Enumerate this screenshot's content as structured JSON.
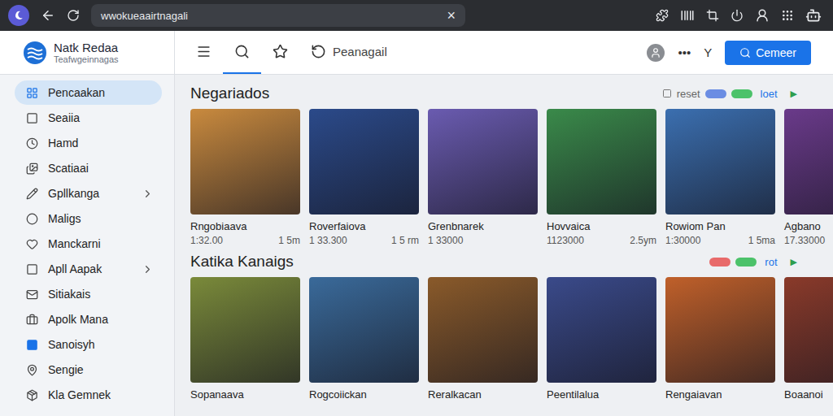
{
  "browser": {
    "address": "wwokueaairtnagali",
    "close": "×"
  },
  "app": {
    "title": "Natk Redaa",
    "subtitle": "Teafwgeinnagas"
  },
  "toolbar": {
    "tabs": [
      {
        "kind": "menu",
        "selected": false
      },
      {
        "kind": "search",
        "selected": true
      },
      {
        "kind": "star",
        "selected": false
      },
      {
        "kind": "link",
        "label": "Peanagail",
        "selected": false
      }
    ],
    "more": "•••",
    "letter": "Y",
    "button": "Cemeer"
  },
  "sidebar": {
    "items": [
      {
        "label": "Pencaakan",
        "selected": true,
        "expandable": false
      },
      {
        "label": "Seaiia",
        "selected": false,
        "expandable": false
      },
      {
        "label": "Hamd",
        "selected": false,
        "expandable": false
      },
      {
        "label": "Scatiaai",
        "selected": false,
        "expandable": false
      },
      {
        "label": "Gpllkanga",
        "selected": false,
        "expandable": true
      },
      {
        "label": "Maligs",
        "selected": false,
        "expandable": false
      },
      {
        "label": "Manckarni",
        "selected": false,
        "expandable": false
      },
      {
        "label": "Apll Aapak",
        "selected": false,
        "expandable": true
      },
      {
        "label": "Sitiakais",
        "selected": false,
        "expandable": false
      },
      {
        "label": "Apolk Mana",
        "selected": false,
        "expandable": false
      },
      {
        "label": "Sanoisyh",
        "selected": false,
        "expandable": false
      },
      {
        "label": "Sengie",
        "selected": false,
        "expandable": false
      },
      {
        "label": "Kla Gemnek",
        "selected": false,
        "expandable": false
      }
    ]
  },
  "sections": [
    {
      "title": "Negariados",
      "controls": {
        "label": "reset",
        "pills": [
          {
            "color": "#6b8de3"
          },
          {
            "color": "#4cc26a"
          }
        ],
        "link": "loet",
        "arrow": "▶"
      },
      "cards": [
        {
          "title": "Rngobiaava",
          "price": "1:32.00",
          "duration": "1 5m",
          "color": "#c98a3e"
        },
        {
          "title": "Roverfaiova",
          "price": "1 33.300",
          "duration": "1 5 rm",
          "color": "#2b4a8a"
        },
        {
          "title": "Grenbnarek",
          "price": "1 33000",
          "color": "#6a5bb0"
        },
        {
          "title": "Hovvaica",
          "price": "1123000",
          "duration": "2.5ym",
          "color": "#3a8a4a"
        },
        {
          "title": "Rowiom Pan",
          "price": "1:30000",
          "duration": "1 5ma",
          "color": "#3b6fb0"
        },
        {
          "title": "Agbano",
          "price": "17.33000",
          "color": "#6a3a8a"
        }
      ]
    },
    {
      "title": "Katika Kanaigs",
      "controls": {
        "pills": [
          {
            "color": "#e86a6a"
          },
          {
            "color": "#4cc26a"
          }
        ],
        "link": "rot",
        "arrow": "▶"
      },
      "cards": [
        {
          "title": "Sopanaava",
          "color": "#7a8a3a"
        },
        {
          "title": "Rogcoiickan",
          "color": "#3a6a9a"
        },
        {
          "title": "Reralkacan",
          "color": "#8a5a2a"
        },
        {
          "title": "Peentilalua",
          "color": "#3a4a8a"
        },
        {
          "title": "Rengaiavan",
          "color": "#c0602a"
        },
        {
          "title": "Boaanoi",
          "color": "#8a3a2a"
        }
      ]
    }
  ]
}
